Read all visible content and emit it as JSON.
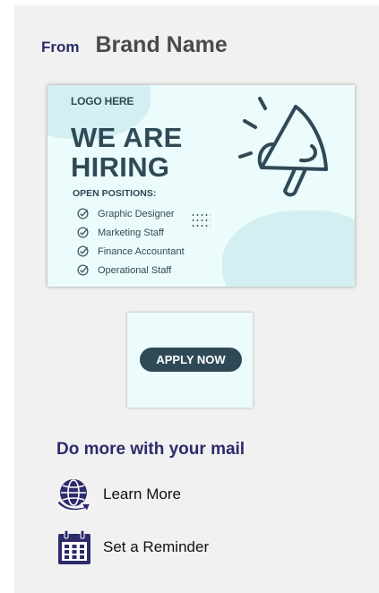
{
  "header": {
    "from_label": "From",
    "brand_name": "Brand Name"
  },
  "banner": {
    "logo_text": "LOGO HERE",
    "headline_line1": "WE ARE",
    "headline_line2": "HIRING",
    "positions_title": "OPEN POSITIONS:",
    "positions": [
      "Graphic Designer",
      "Marketing Staff",
      "Finance Accountant",
      "Operational Staff"
    ]
  },
  "apply": {
    "label": "APPLY NOW"
  },
  "more": {
    "title": "Do more with your mail",
    "actions": [
      {
        "label": "Learn More",
        "icon": "globe-icon"
      },
      {
        "label": "Set a Reminder",
        "icon": "calendar-icon"
      }
    ]
  },
  "colors": {
    "accent_navy": "#2c2c6b",
    "banner_text": "#2f4a56",
    "banner_bg": "#ecfbfb"
  }
}
